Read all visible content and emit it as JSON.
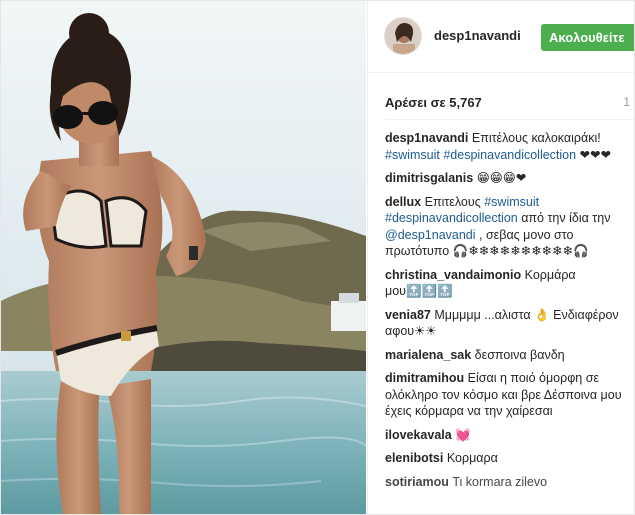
{
  "profile": {
    "username": "desp1navandi",
    "follow_label": "Ακολουθείτε"
  },
  "post": {
    "likes": "Αρέσει σε 5,767",
    "time": "1"
  },
  "comments": [
    {
      "user": "desp1navandi",
      "parts": [
        {
          "t": "Επιτέλους καλοκαιράκι! "
        },
        {
          "t": "#swimsuit #despinavandicollection",
          "tag": true
        },
        {
          "t": " ❤❤❤"
        }
      ]
    },
    {
      "user": "dimitrisgalanis",
      "parts": [
        {
          "t": "😁😁😁❤"
        }
      ]
    },
    {
      "user": "dellux",
      "parts": [
        {
          "t": "Επιτελους "
        },
        {
          "t": "#swimsuit #despinavandicollection",
          "tag": true
        },
        {
          "t": " από την ίδια την "
        },
        {
          "t": "@desp1navandi",
          "tag": true
        },
        {
          "t": " , σεβας μονο στο πρωτότυπο 🎧❄❄❄❄❄❄❄❄❄❄🎧"
        }
      ]
    },
    {
      "user": "christina_vandaimonio",
      "parts": [
        {
          "t": "Κορμάρα μου🔝🔝🔝"
        }
      ]
    },
    {
      "user": "venia87",
      "parts": [
        {
          "t": "Μμμμμμ ...αλιστα 👌 Ενδιαφέρον αφου☀☀"
        }
      ]
    },
    {
      "user": "marialena_sak",
      "parts": [
        {
          "t": "δεσποινα βανδη"
        }
      ]
    },
    {
      "user": "dimitramihou",
      "parts": [
        {
          "t": "Είσαι η ποιό όμορφη σε ολόκληρο τον κόσμο και βρε Δέσποινα μου έχεις κόρμαρα να την χαίρεσαι"
        }
      ]
    },
    {
      "user": "ilovekavala",
      "parts": [
        {
          "t": "💓"
        }
      ]
    },
    {
      "user": "elenibotsi",
      "parts": [
        {
          "t": "Κορμαρα"
        }
      ]
    },
    {
      "user": "sotiriamou",
      "parts": [
        {
          "t": "Τι kormara zilevo"
        }
      ]
    }
  ]
}
